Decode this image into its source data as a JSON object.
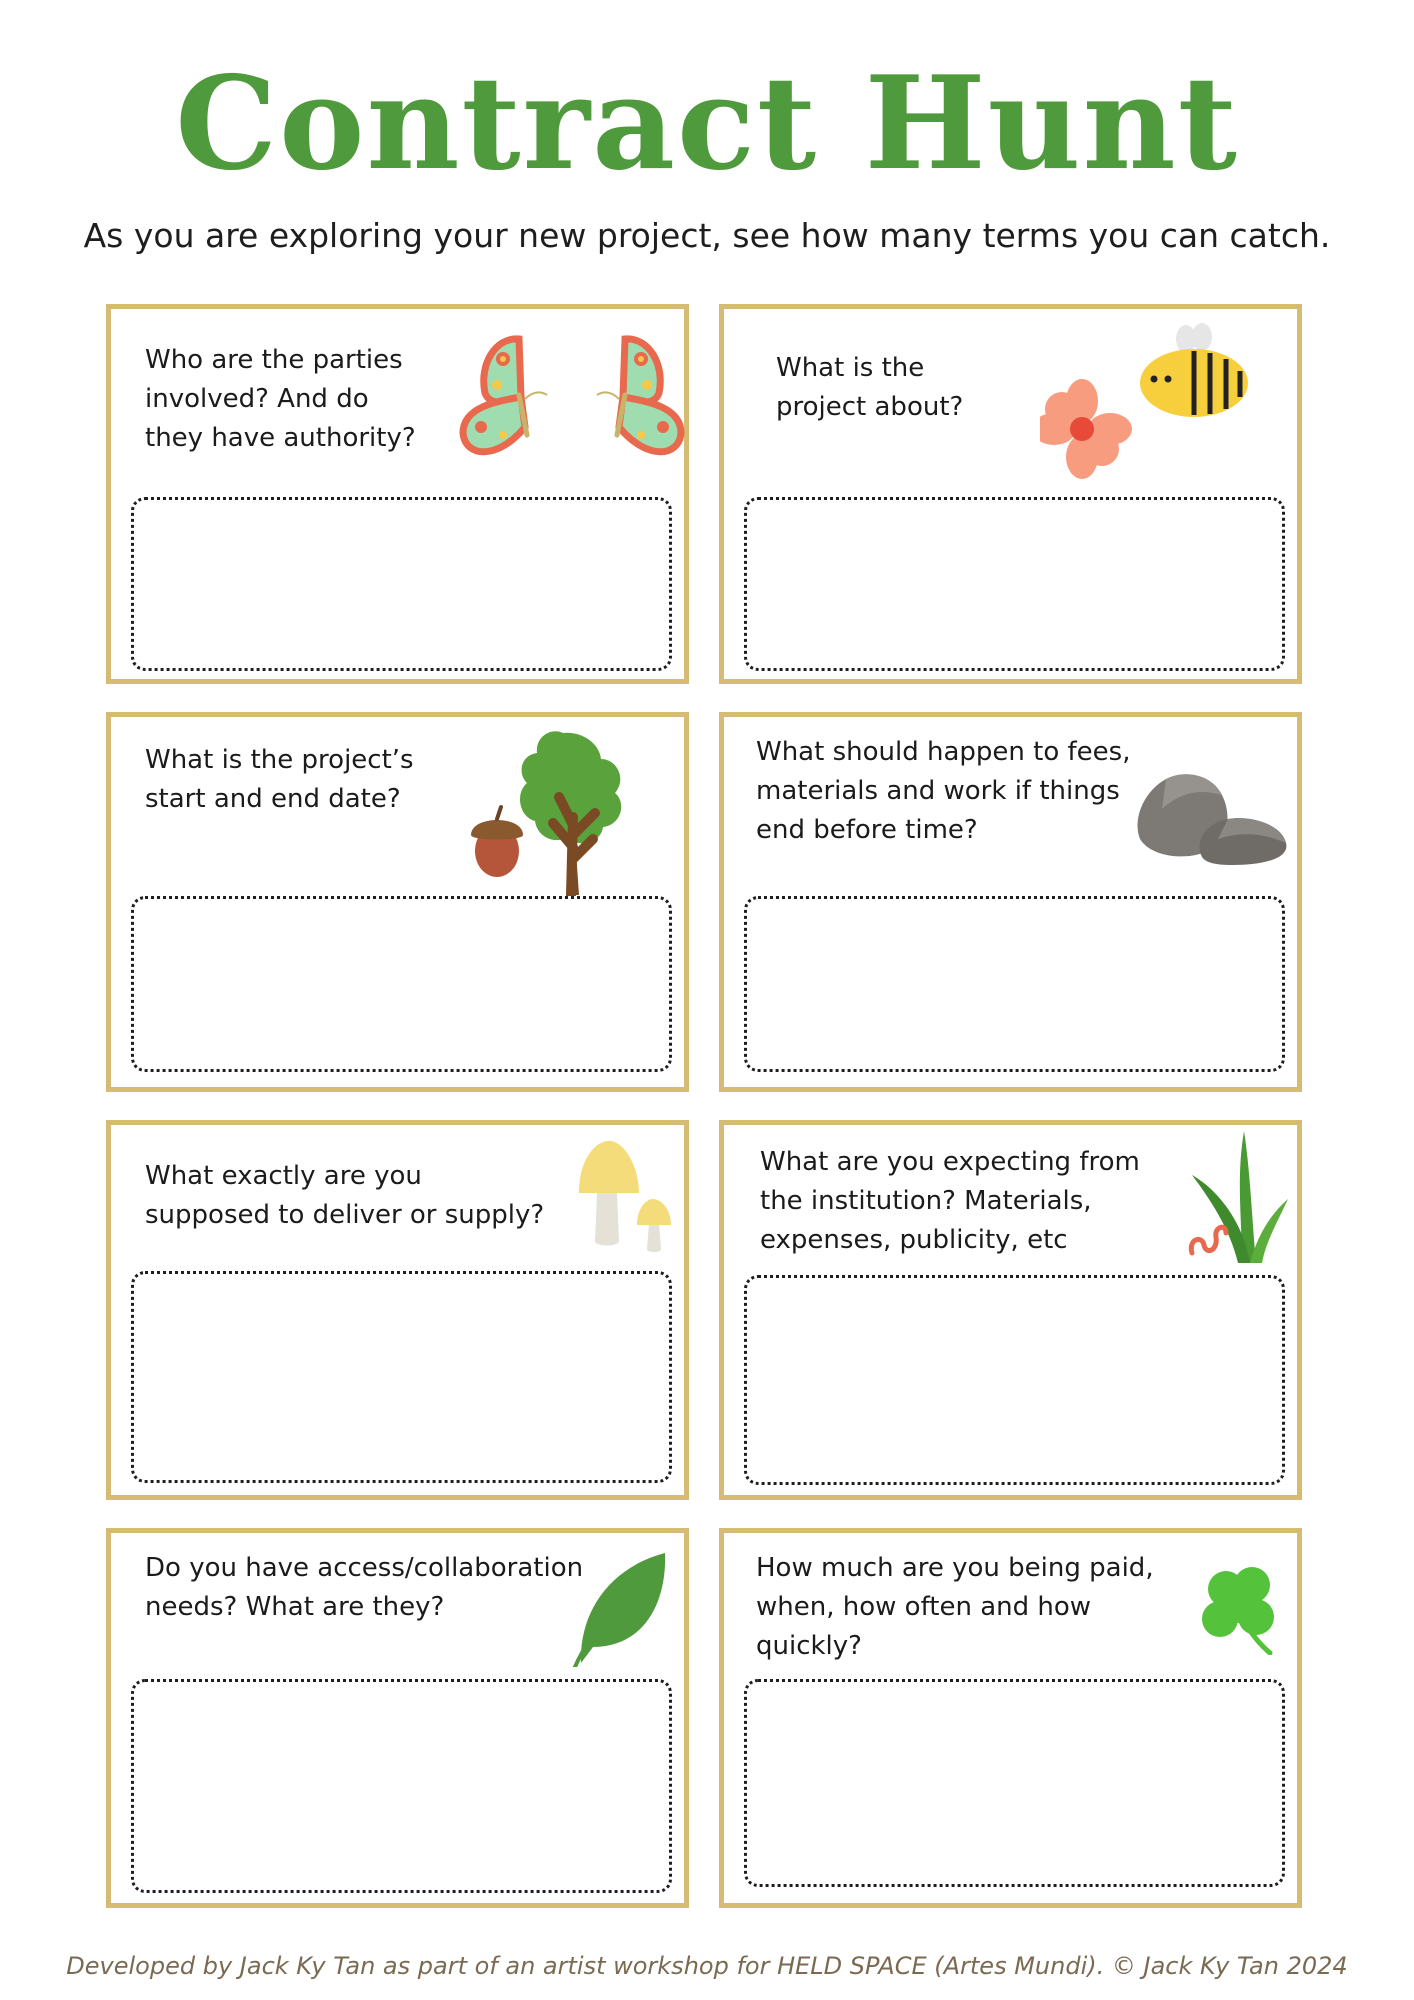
{
  "title": "Contract Hunt",
  "subtitle": "As you are exploring your new project, see how many terms you can catch.",
  "cards": [
    {
      "question": "Who are the parties\ninvolved? And do\nthey have authority?",
      "art": "butterflies-icon"
    },
    {
      "question": "What is the\nproject about?",
      "art": "flower-and-bee-icon"
    },
    {
      "question": "What is the project’s\nstart and end date?",
      "art": "acorn-and-tree-icon"
    },
    {
      "question": "What should happen to fees,\nmaterials and work if things\nend before time?",
      "art": "rocks-icon"
    },
    {
      "question": "What exactly are you\nsupposed to deliver or supply?",
      "art": "mushrooms-icon"
    },
    {
      "question": "What are you expecting from\nthe institution? Materials,\nexpenses, publicity, etc",
      "art": "grass-and-worm-icon"
    },
    {
      "question": "Do you have access/collaboration\nneeds? What are they?",
      "art": "leaf-icon"
    },
    {
      "question": "How much are you being paid,\nwhen, how often and how\nquickly?",
      "art": "clover-icon"
    }
  ],
  "footer": "Developed by Jack Ky Tan as part of an artist workshop for HELD SPACE (Artes Mundi). © Jack Ky Tan 2024",
  "colors": {
    "title_green": "#4f9a3c",
    "card_border": "#d6bc73",
    "footer_brown": "#7a6a52"
  }
}
